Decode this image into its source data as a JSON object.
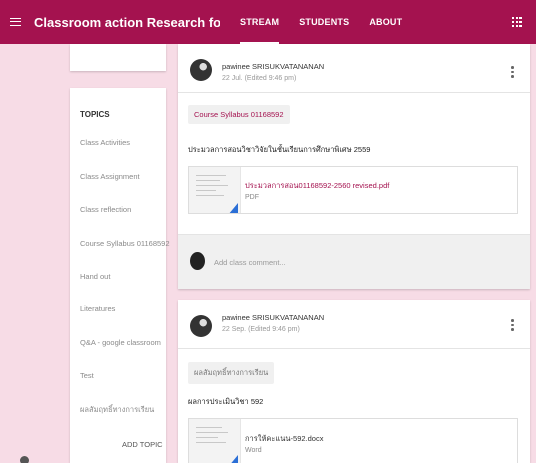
{
  "header": {
    "title": "Classroom action Research for Special Edu...",
    "tabs": [
      "STREAM",
      "STUDENTS",
      "ABOUT"
    ]
  },
  "sidebar": {
    "heading": "TOPICS",
    "items": [
      "Class Activities",
      "Class Assignment",
      "Class reflection",
      "Course Syllabus 01168592",
      "Hand out",
      "Literatures",
      "Q&A - google classroom",
      "Test",
      "ผลสัมฤทธิ์ทางการเรียน"
    ],
    "add_topic": "ADD TOPIC"
  },
  "posts": [
    {
      "author": "pawinee SRISUKVATANANAN",
      "date": "22 Jul. (Edited 9:46 pm)",
      "topic": "Course Syllabus 01168592",
      "text": "ประมวลการสอนวิชาวิจัยในชั้นเรียนการศึกษาพิเศษ 2559",
      "attachment": {
        "name": "ประมวลการสอน01168592-2560 revised.pdf",
        "type": "PDF"
      },
      "comment_placeholder": "Add class comment..."
    },
    {
      "author": "pawinee SRISUKVATANANAN",
      "date": "22 Sep. (Edited 9:46 pm)",
      "topic": "ผลสัมฤทธิ์ทางการเรียน",
      "text": "ผลการประเมินวิชา 592",
      "attachment": {
        "name": "การให้คะแนน-592.docx",
        "type": "Word"
      }
    }
  ],
  "colors": {
    "brand": "#a4124f",
    "background": "#f7dce6",
    "file_corner": "#2b6fd6"
  },
  "icons": [
    "menu-icon",
    "apps-grid-icon",
    "more-vert-icon",
    "avatar",
    "file-thumbnail"
  ]
}
